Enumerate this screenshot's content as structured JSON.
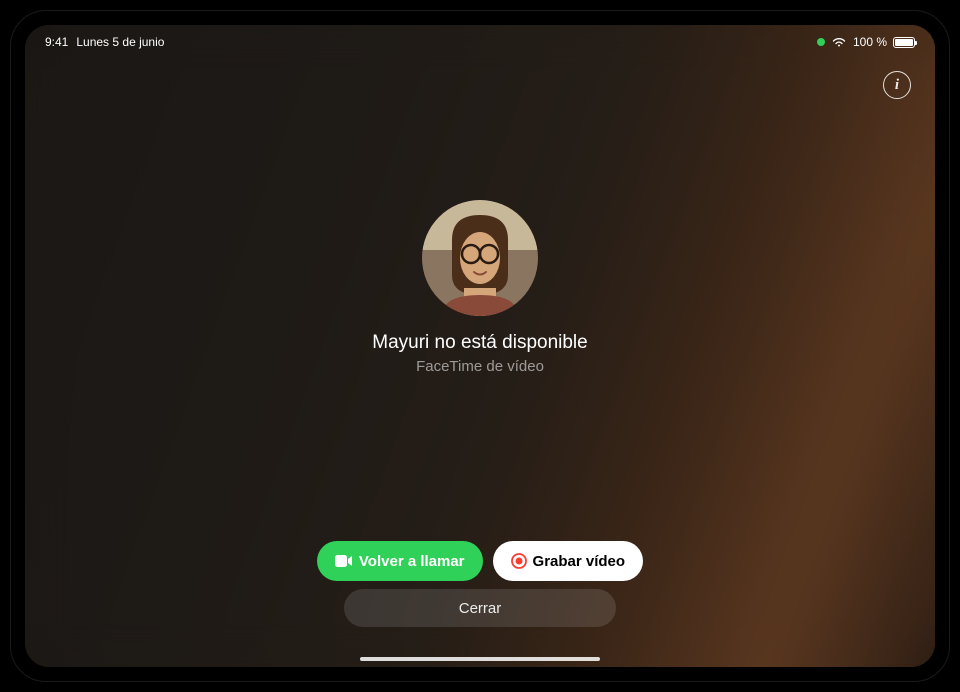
{
  "statusBar": {
    "time": "9:41",
    "date": "Lunes 5 de junio",
    "battery": "100 %"
  },
  "contact": {
    "statusMessage": "Mayuri no está disponible",
    "subtitle": "FaceTime de vídeo"
  },
  "buttons": {
    "callAgain": "Volver a llamar",
    "recordVideo": "Grabar vídeo",
    "close": "Cerrar"
  },
  "infoButton": {
    "label": "i"
  }
}
